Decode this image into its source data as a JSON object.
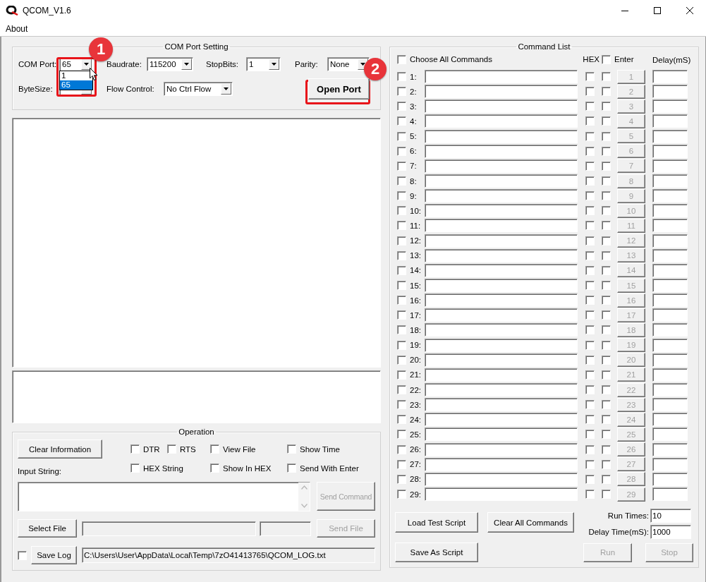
{
  "window": {
    "title": "QCOM_V1.6",
    "menu": [
      "About"
    ]
  },
  "com_port_setting": {
    "title": "COM Port Setting",
    "com_port": {
      "label": "COM Port:",
      "value": "65",
      "expanded": true,
      "options": [
        {
          "label": "1",
          "selected": false
        },
        {
          "label": "65",
          "selected": true
        }
      ]
    },
    "baudrate": {
      "label": "Baudrate:",
      "value": "115200"
    },
    "stop_bits": {
      "label": "StopBits:",
      "value": "1"
    },
    "parity": {
      "label": "Parity:",
      "value": "None"
    },
    "byte_size": {
      "label": "ByteSize:"
    },
    "flow_control": {
      "label": "Flow Control:",
      "value": "No Ctrl Flow"
    },
    "open_port_button": "Open Port"
  },
  "operation": {
    "title": "Operation",
    "clear_button": "Clear Information",
    "checkboxes": [
      {
        "label": "DTR",
        "checked": false
      },
      {
        "label": "RTS",
        "checked": false
      },
      {
        "label": "View File",
        "checked": false
      },
      {
        "label": "Show Time",
        "checked": false
      },
      {
        "label": "HEX String",
        "checked": false
      },
      {
        "label": "Show In HEX",
        "checked": false
      },
      {
        "label": "Send With Enter",
        "checked": false
      }
    ],
    "input_label": "Input String:",
    "send_command_button": {
      "label": "Send Command",
      "disabled": true
    },
    "select_file_button": "Select File",
    "send_file_button": {
      "label": "Send File",
      "disabled": true
    },
    "save_log": {
      "checked": false,
      "button": "Save Log",
      "path": "C:\\Users\\User\\AppData\\Local\\Temp\\7zO41413765\\QCOM_LOG.txt"
    }
  },
  "command_list": {
    "title": "Command List",
    "choose_all": {
      "label": "Choose All Commands",
      "checked": false
    },
    "hex_label": "HEX",
    "enter": {
      "label": "Enter",
      "checked": false
    },
    "delay_label": "Delay(mS)",
    "rows": [
      {
        "label": "1:",
        "button": "1",
        "checked": false,
        "hex": false,
        "enter": false,
        "disabled": true
      },
      {
        "label": "2:",
        "button": "2",
        "checked": false,
        "hex": false,
        "enter": false,
        "disabled": true
      },
      {
        "label": "3:",
        "button": "3",
        "checked": false,
        "hex": false,
        "enter": false,
        "disabled": true
      },
      {
        "label": "4:",
        "button": "4",
        "checked": false,
        "hex": false,
        "enter": false,
        "disabled": true
      },
      {
        "label": "5:",
        "button": "5",
        "checked": false,
        "hex": false,
        "enter": false,
        "disabled": true
      },
      {
        "label": "6:",
        "button": "6",
        "checked": false,
        "hex": false,
        "enter": false,
        "disabled": true
      },
      {
        "label": "7:",
        "button": "7",
        "checked": false,
        "hex": false,
        "enter": false,
        "disabled": true
      },
      {
        "label": "8:",
        "button": "8",
        "checked": false,
        "hex": false,
        "enter": false,
        "disabled": true
      },
      {
        "label": "9:",
        "button": "9",
        "checked": false,
        "hex": false,
        "enter": false,
        "disabled": true
      },
      {
        "label": "10:",
        "button": "10",
        "checked": false,
        "hex": false,
        "enter": false,
        "disabled": true
      },
      {
        "label": "11:",
        "button": "11",
        "checked": false,
        "hex": false,
        "enter": false,
        "disabled": true
      },
      {
        "label": "12:",
        "button": "12",
        "checked": false,
        "hex": false,
        "enter": false,
        "disabled": true
      },
      {
        "label": "13:",
        "button": "13",
        "checked": false,
        "hex": false,
        "enter": false,
        "disabled": true
      },
      {
        "label": "14:",
        "button": "14",
        "checked": false,
        "hex": false,
        "enter": false,
        "disabled": true
      },
      {
        "label": "15:",
        "button": "15",
        "checked": false,
        "hex": false,
        "enter": false,
        "disabled": true
      },
      {
        "label": "16:",
        "button": "16",
        "checked": false,
        "hex": false,
        "enter": false,
        "disabled": true
      },
      {
        "label": "17:",
        "button": "17",
        "checked": false,
        "hex": false,
        "enter": false,
        "disabled": true
      },
      {
        "label": "18:",
        "button": "18",
        "checked": false,
        "hex": false,
        "enter": false,
        "disabled": true
      },
      {
        "label": "19:",
        "button": "19",
        "checked": false,
        "hex": false,
        "enter": false,
        "disabled": true
      },
      {
        "label": "20:",
        "button": "20",
        "checked": false,
        "hex": false,
        "enter": false,
        "disabled": true
      },
      {
        "label": "21:",
        "button": "21",
        "checked": false,
        "hex": false,
        "enter": false,
        "disabled": true
      },
      {
        "label": "22:",
        "button": "22",
        "checked": false,
        "hex": false,
        "enter": false,
        "disabled": true
      },
      {
        "label": "23:",
        "button": "23",
        "checked": false,
        "hex": false,
        "enter": false,
        "disabled": true
      },
      {
        "label": "24:",
        "button": "24",
        "checked": false,
        "hex": false,
        "enter": false,
        "disabled": true
      },
      {
        "label": "25:",
        "button": "25",
        "checked": false,
        "hex": false,
        "enter": false,
        "disabled": true
      },
      {
        "label": "26:",
        "button": "26",
        "checked": false,
        "hex": false,
        "enter": false,
        "disabled": true
      },
      {
        "label": "27:",
        "button": "27",
        "checked": false,
        "hex": false,
        "enter": false,
        "disabled": true
      },
      {
        "label": "28:",
        "button": "28",
        "checked": false,
        "hex": false,
        "enter": false,
        "disabled": true
      },
      {
        "label": "29:",
        "button": "29",
        "checked": false,
        "hex": false,
        "enter": false,
        "disabled": true
      }
    ],
    "load_button": "Load Test Script",
    "clear_button": "Clear All Commands",
    "save_button": "Save As Script",
    "run_times": {
      "label": "Run Times:",
      "value": "10"
    },
    "delay_time": {
      "label": "Delay Time(mS):",
      "value": "1000"
    },
    "run_button": {
      "label": "Run",
      "disabled": true
    },
    "stop_button": {
      "label": "Stop",
      "disabled": true
    }
  },
  "annotations": [
    {
      "label": "1"
    },
    {
      "label": "2"
    }
  ]
}
